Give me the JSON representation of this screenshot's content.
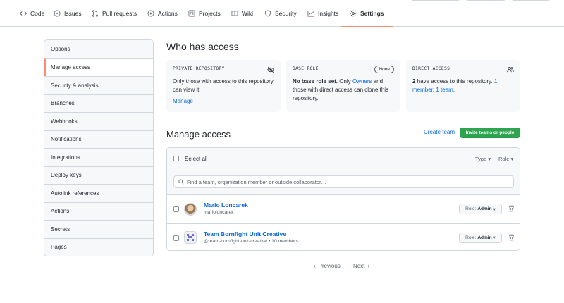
{
  "topnav": {
    "tabs": [
      {
        "label": "Code",
        "icon": "code-icon"
      },
      {
        "label": "Issues",
        "icon": "issue-icon"
      },
      {
        "label": "Pull requests",
        "icon": "pull-request-icon"
      },
      {
        "label": "Actions",
        "icon": "play-icon"
      },
      {
        "label": "Projects",
        "icon": "project-icon"
      },
      {
        "label": "Wiki",
        "icon": "book-icon"
      },
      {
        "label": "Security",
        "icon": "shield-icon"
      },
      {
        "label": "Insights",
        "icon": "graph-icon"
      },
      {
        "label": "Settings",
        "icon": "gear-icon",
        "active": true
      }
    ]
  },
  "sidebar": {
    "items": [
      "Options",
      "Manage access",
      "Security & analysis",
      "Branches",
      "Webhooks",
      "Notifications",
      "Integrations",
      "Deploy keys",
      "Autolink references",
      "Actions",
      "Secrets",
      "Pages"
    ],
    "selected": "Manage access"
  },
  "who": {
    "title": "Who has access",
    "private": {
      "label": "PRIVATE REPOSITORY",
      "text": "Only those with access to this repository can view it.",
      "link": "Manage"
    },
    "base_role": {
      "label": "BASE ROLE",
      "badge": "None",
      "bold": "No base role set.",
      "text_a": " Only ",
      "link": "Owners",
      "text_b": " and those with direct access can clone this repository."
    },
    "direct": {
      "label": "DIRECT ACCESS",
      "count": "2",
      "text": " have access to this repository. ",
      "member_link": "1 member",
      "sep": ". ",
      "team_link": "1 team",
      "end": "."
    }
  },
  "manage": {
    "title": "Manage access",
    "create_team": "Create team",
    "invite_button": "Invite teams or people",
    "select_all": "Select all",
    "type_filter": "Type",
    "role_filter": "Role",
    "search_placeholder": "Find a team, organization member or outside collaborator…",
    "rows": [
      {
        "name": "Mario Loncarek",
        "sub": "marioloncarek",
        "role_prefix": "Role:",
        "role": "Admin"
      },
      {
        "name": "Team Bornfight Unit Creative",
        "sub": "@team-bornfight-unit-creative • 10 members",
        "role_prefix": "Role:",
        "role": "Admin"
      }
    ]
  },
  "pagination": {
    "previous": "Previous",
    "next": "Next"
  },
  "colors": {
    "accent": "#fd8c73",
    "link": "#0969da",
    "primary_button": "#2da44e"
  }
}
